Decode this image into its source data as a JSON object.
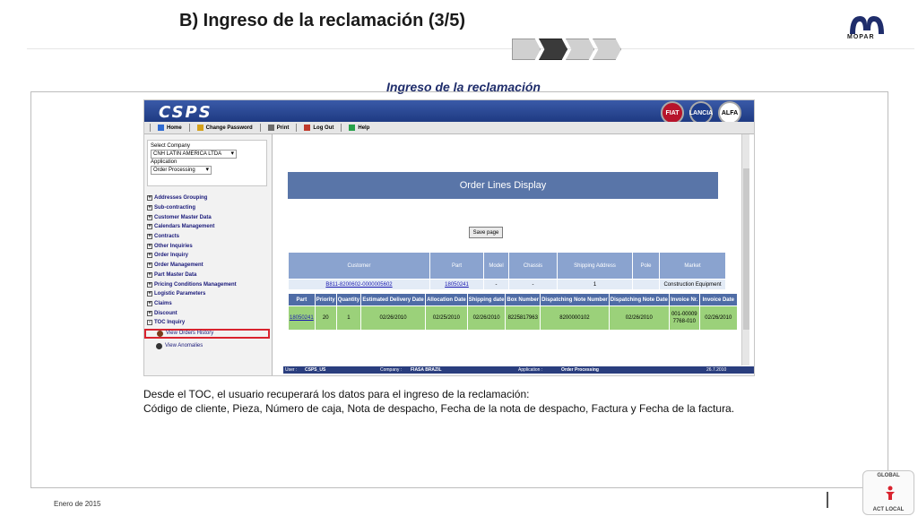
{
  "slide": {
    "title": "B) Ingreso de la reclamación (3/5)",
    "subtitle": "Ingreso de la reclamación",
    "logo_text": "MOPAR",
    "steps": [
      {
        "state": "inactive"
      },
      {
        "state": "active"
      },
      {
        "state": "inactive"
      },
      {
        "state": "inactive"
      }
    ],
    "description": [
      "Desde el TOC, el usuario recuperará los datos para el ingreso de la reclamación:",
      "Código de cliente, Pieza, Número de caja, Nota de despacho, Fecha de la nota de despacho, Factura y Fecha de la factura."
    ],
    "footer_date": "Enero de 2015",
    "badge": {
      "top": "GLOBAL",
      "bottom": "ACT LOCAL"
    }
  },
  "app": {
    "logo": "CSPS",
    "brands": [
      "FIAT",
      "LANCIA",
      "ALFA"
    ],
    "menu": [
      {
        "label": "Home",
        "icon": "home-icon"
      },
      {
        "label": "Change Password",
        "icon": "key-icon"
      },
      {
        "label": "Print",
        "icon": "printer-icon"
      },
      {
        "label": "Log Out",
        "icon": "logout-icon"
      },
      {
        "label": "Help",
        "icon": "help-icon"
      }
    ],
    "sidebar": {
      "select_company_label": "Select Company",
      "company_value": "CNH LATIN AMERICA LTDA",
      "application_label": "Application",
      "application_value": "Order Processing",
      "tree": [
        "Addresses Grouping",
        "Sub-contracting",
        "Customer Master Data",
        "Calendars Management",
        "Contracts",
        "Other Inquiries",
        "Order Inquiry",
        "Order Management",
        "Part Master Data",
        "Pricing Conditions Management",
        "Logistic Parameters",
        "Claims",
        "Discount",
        "TOC Inquiry"
      ],
      "subitems": [
        "View Orders History",
        "View Anomalies"
      ]
    },
    "panel_title": "Order Lines Display",
    "save_button": "Save page",
    "grid1": {
      "headers": [
        "Customer",
        "Part",
        "Model",
        "Chassis",
        "Shipping Address",
        "Pole",
        "Market"
      ],
      "row": [
        "B811-8200602-0000005602",
        "18050241",
        "-",
        "-",
        "1",
        "",
        "Construction Equipment"
      ]
    },
    "grid2": {
      "headers": [
        "Part",
        "Priority",
        "Quantity",
        "Estimated Delivery Date",
        "Allocation Date",
        "Shipping date",
        "Box Number",
        "Dispatching Note Number",
        "Dispatching Note Date",
        "Invoice Nr.",
        "Invoice Date"
      ],
      "row": [
        "18050241",
        "20",
        "1",
        "02/26/2010",
        "02/25/2010",
        "02/26/2010",
        "8225817963",
        "8200000102",
        "02/26/2010",
        "001-000097768-010",
        "02/26/2010"
      ]
    },
    "status": {
      "user": "User :",
      "user_value": "CSPS_US",
      "company": "Company :",
      "company_value": "FIASA BRAZIL",
      "application": "Application :",
      "application_value": "Order Processing",
      "date": "26.7.2010"
    }
  }
}
